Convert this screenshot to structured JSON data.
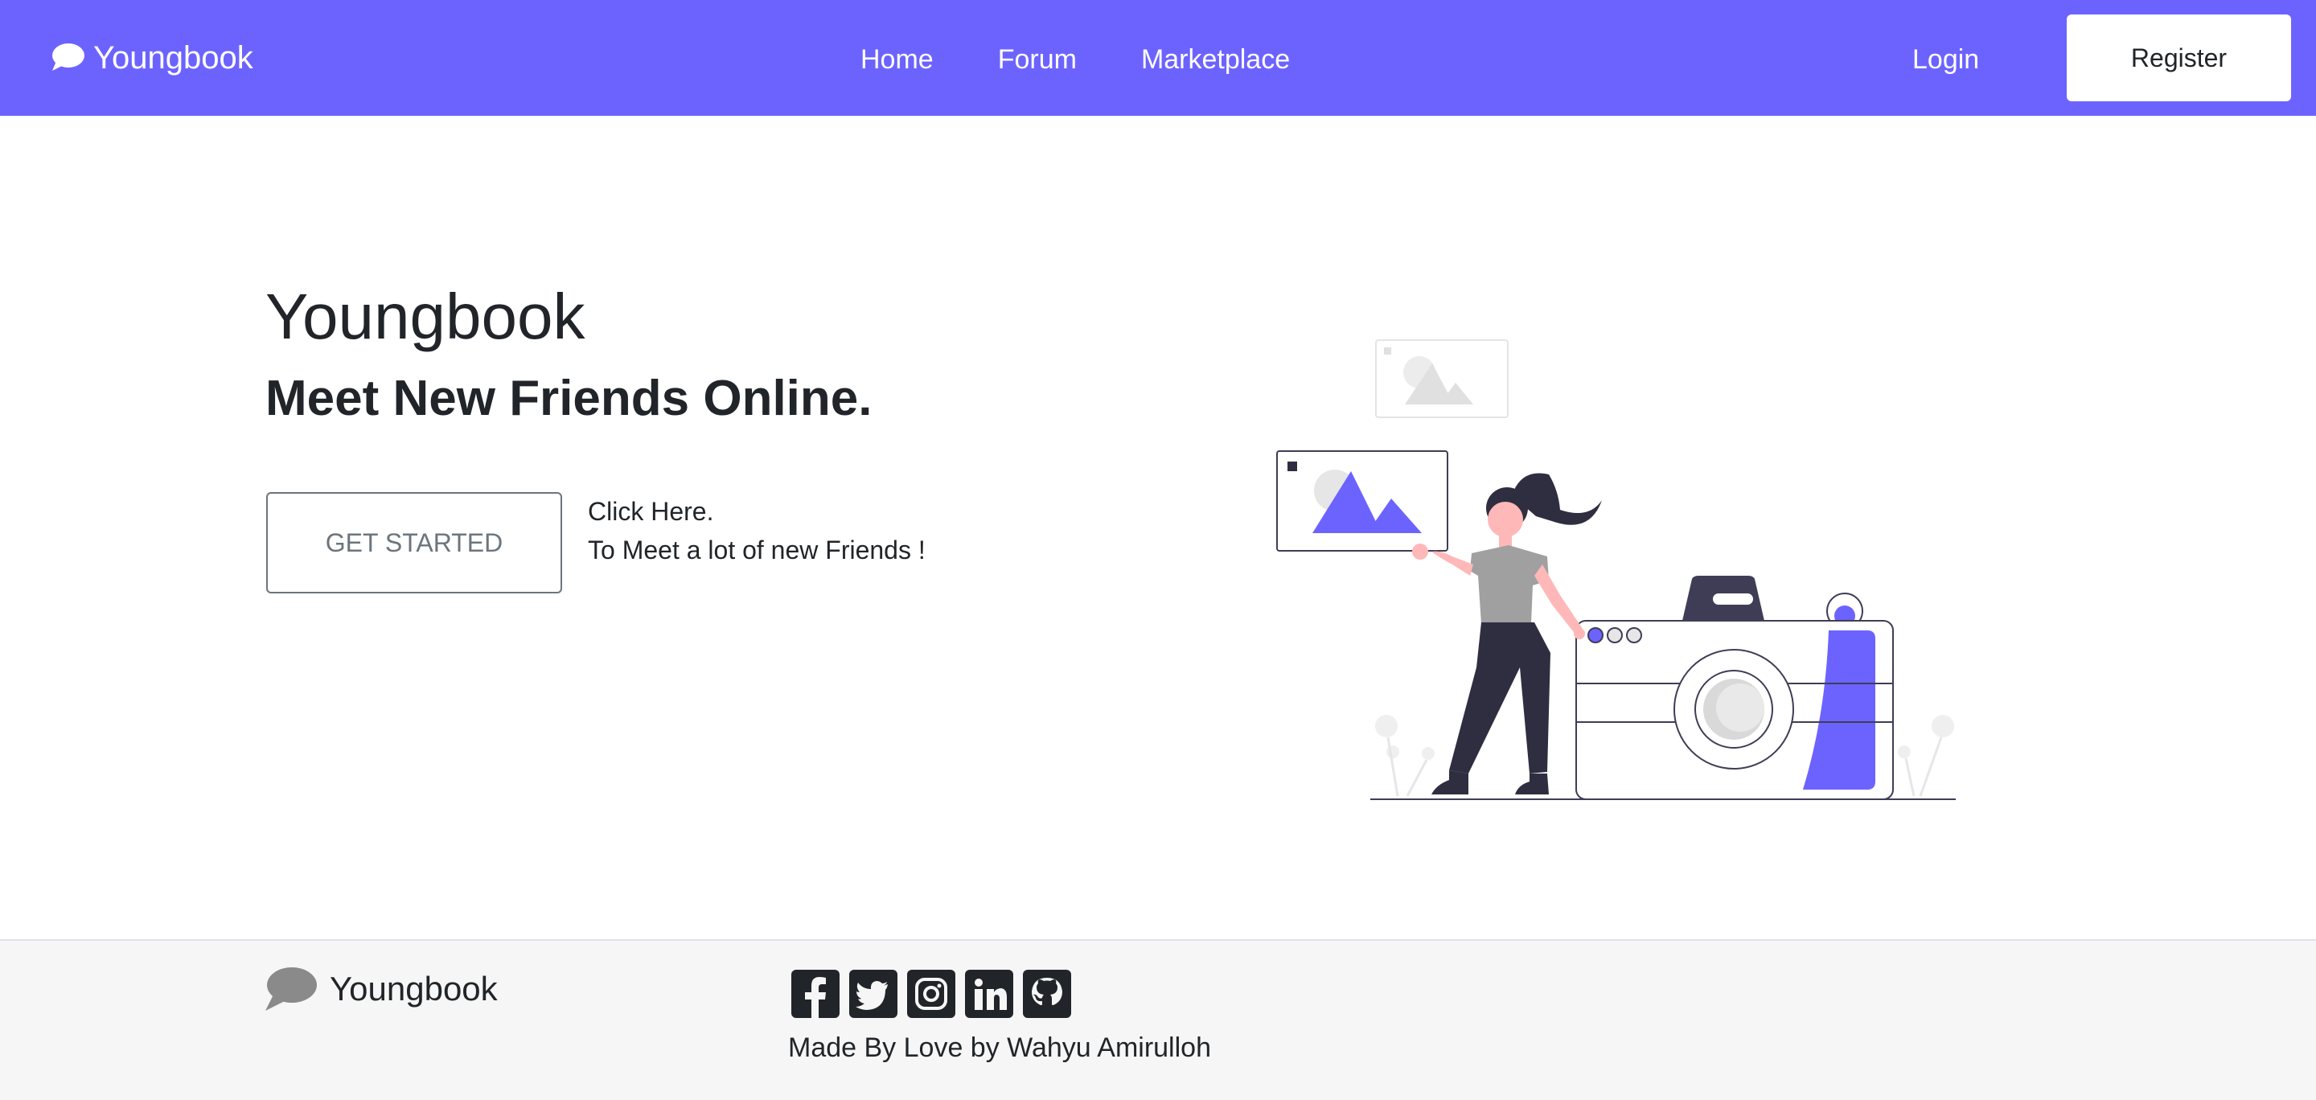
{
  "nav": {
    "brand": "Youngbook",
    "links": [
      "Home",
      "Forum",
      "Marketplace"
    ],
    "login": "Login",
    "register": "Register"
  },
  "hero": {
    "title": "Youngbook",
    "subtitle": "Meet New Friends Online.",
    "cta_label": "GET STARTED",
    "cta_line1": "Click Here.",
    "cta_line2": "To Meet a lot of new Friends !"
  },
  "footer": {
    "brand": "Youngbook",
    "socials": [
      "facebook-icon",
      "twitter-icon",
      "instagram-icon",
      "linkedin-icon",
      "github-icon"
    ],
    "credit": "Made By Love by Wahyu Amirulloh"
  },
  "colors": {
    "primary": "#6c63ff",
    "dark": "#2f2e41",
    "footer_bg": "#f6f6f6"
  }
}
